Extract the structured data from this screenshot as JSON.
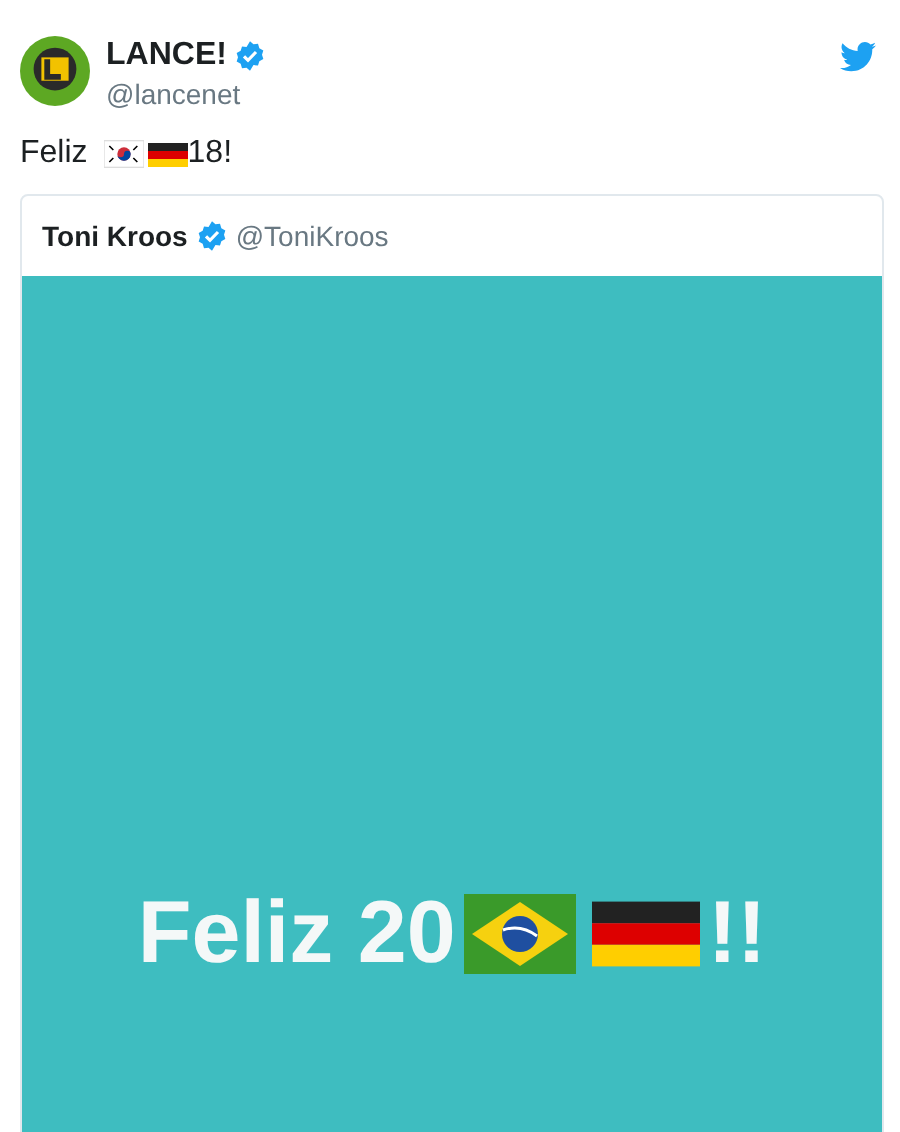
{
  "tweet": {
    "author": {
      "name": "LANCE!",
      "handle": "@lancenet",
      "verified": true
    },
    "text_start": "Feliz",
    "text_end": "18!",
    "quoted_tweet": {
      "author": {
        "name": "Toni Kroos",
        "handle": "@ToniKroos",
        "verified": true
      },
      "media": {
        "caption_start": "Feliz 20",
        "caption_end": "!!"
      }
    }
  }
}
